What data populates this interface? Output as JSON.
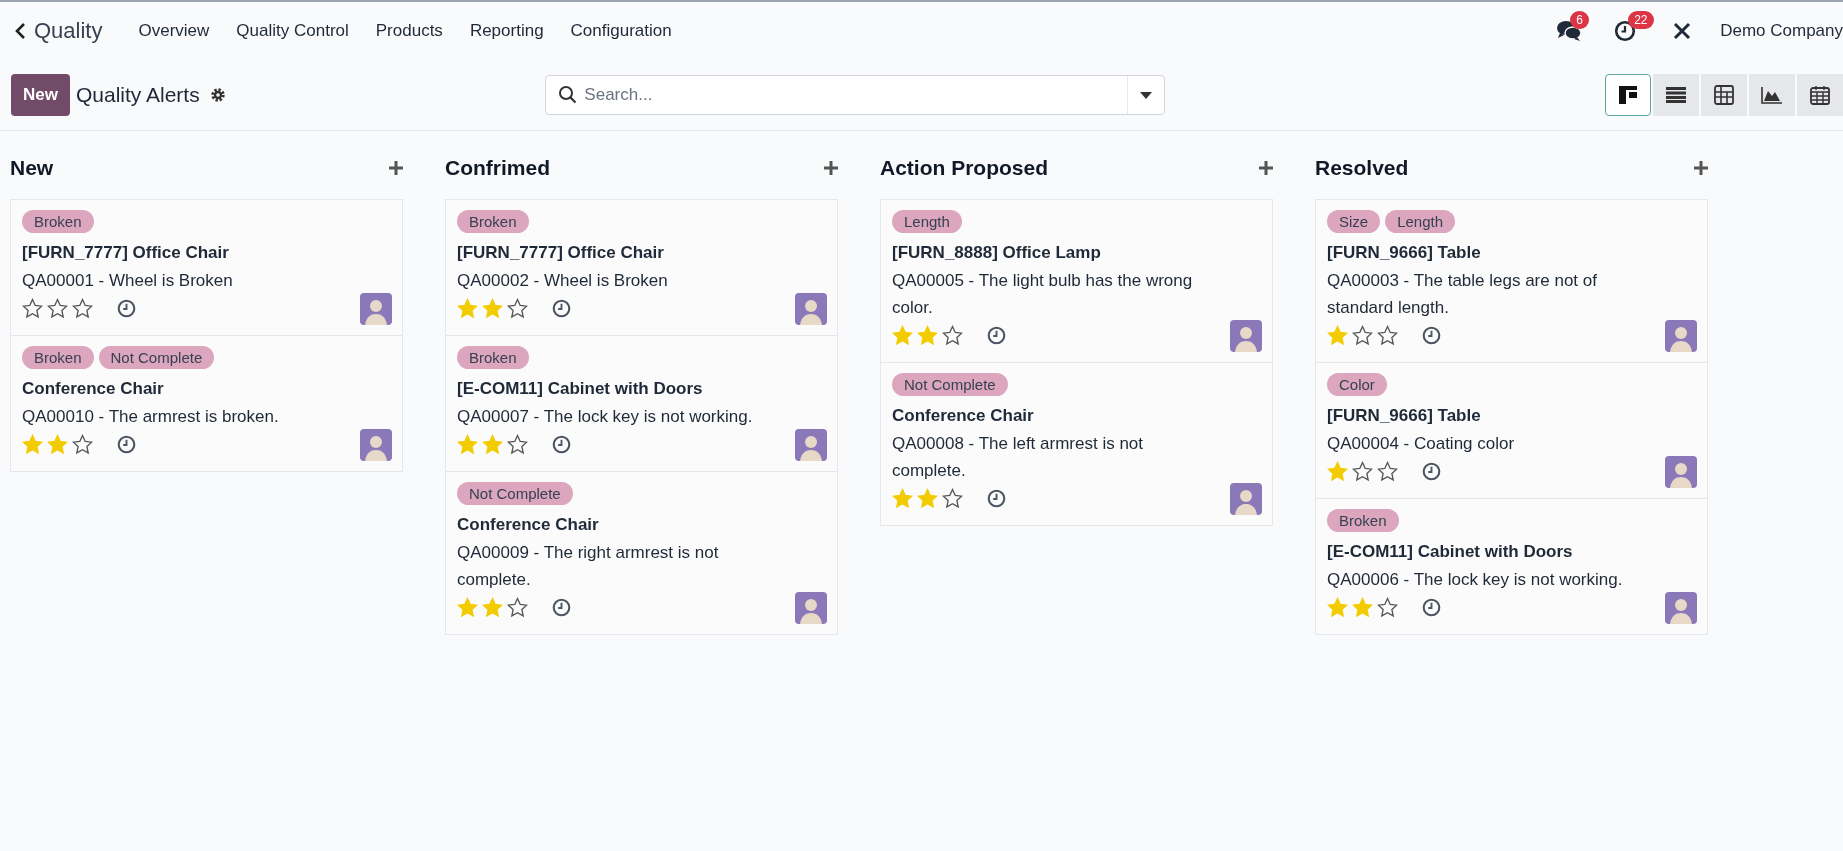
{
  "navbar": {
    "app": "Quality",
    "menu": [
      "Overview",
      "Quality Control",
      "Products",
      "Reporting",
      "Configuration"
    ],
    "messages_count": "6",
    "activities_count": "22",
    "company": "Demo Company"
  },
  "control_panel": {
    "new_button": "New",
    "title": "Quality Alerts",
    "search": {
      "placeholder": "Search..."
    },
    "views": [
      {
        "kind": "kanban",
        "selected": true
      },
      {
        "kind": "list",
        "selected": false
      },
      {
        "kind": "pivot",
        "selected": false
      },
      {
        "kind": "graph",
        "selected": false
      },
      {
        "kind": "calendar",
        "selected": false
      }
    ]
  },
  "columns": [
    {
      "title": "New",
      "cards": [
        {
          "tags": [
            "Broken"
          ],
          "title": "[FURN_7777] Office Chair",
          "description": "QA00001 - Wheel is Broken",
          "stars": 0
        },
        {
          "tags": [
            "Broken",
            "Not Complete"
          ],
          "title": "Conference Chair",
          "description": "QA00010 - The armrest is broken.",
          "stars": 2
        }
      ]
    },
    {
      "title": "Confrimed",
      "cards": [
        {
          "tags": [
            "Broken"
          ],
          "title": "[FURN_7777] Office Chair",
          "description": "QA00002 - Wheel is Broken",
          "stars": 2
        },
        {
          "tags": [
            "Broken"
          ],
          "title": "[E-COM11] Cabinet with Doors",
          "description": "QA00007 - The lock key is not working.",
          "stars": 2
        },
        {
          "tags": [
            "Not Complete"
          ],
          "title": "Conference Chair",
          "description": "QA00009 - The right armrest is not complete.",
          "stars": 2
        }
      ]
    },
    {
      "title": "Action Proposed",
      "cards": [
        {
          "tags": [
            "Length"
          ],
          "title": "[FURN_8888] Office Lamp",
          "description": "QA00005 - The light bulb has the wrong color.",
          "stars": 2
        },
        {
          "tags": [
            "Not Complete"
          ],
          "title": "Conference Chair",
          "description": "QA00008 - The left armrest is not complete.",
          "stars": 2
        }
      ]
    },
    {
      "title": "Resolved",
      "cards": [
        {
          "tags": [
            "Size",
            "Length"
          ],
          "title": "[FURN_9666] Table",
          "description": "QA00003 - The table legs are not of standard length.",
          "stars": 1
        },
        {
          "tags": [
            "Color"
          ],
          "title": "[FURN_9666] Table",
          "description": "QA00004 - Coating color",
          "stars": 1
        },
        {
          "tags": [
            "Broken"
          ],
          "title": "[E-COM11] Cabinet with Doors",
          "description": "QA00006 - The lock key is not working.",
          "stars": 2
        }
      ]
    }
  ]
}
